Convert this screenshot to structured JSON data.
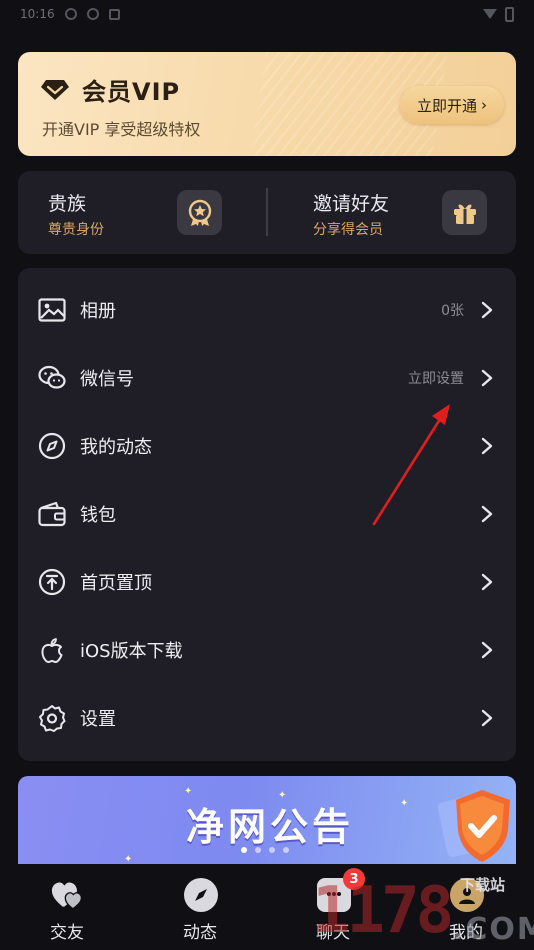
{
  "status_bar": {
    "time": "10:16"
  },
  "vip": {
    "title": "会员VIP",
    "subtitle": "开通VIP 享受超级特权",
    "button_label": "立即开通",
    "button_chevron": "›"
  },
  "noble": {
    "left": {
      "title": "贵族",
      "subtitle": "尊贵身份",
      "icon": "noble-badge-icon"
    },
    "right": {
      "title": "邀请好友",
      "subtitle": "分享得会员",
      "icon": "gift-icon"
    }
  },
  "menu": {
    "items": [
      {
        "label": "相册",
        "value": "0张",
        "icon": "image-icon"
      },
      {
        "label": "微信号",
        "value": "立即设置",
        "icon": "wechat-icon"
      },
      {
        "label": "我的动态",
        "value": "",
        "icon": "compass-icon"
      },
      {
        "label": "钱包",
        "value": "",
        "icon": "wallet-icon"
      },
      {
        "label": "首页置顶",
        "value": "",
        "icon": "pin-top-icon"
      },
      {
        "label": "iOS版本下载",
        "value": "",
        "icon": "apple-icon"
      },
      {
        "label": "设置",
        "value": "",
        "icon": "gear-icon"
      }
    ]
  },
  "banner": {
    "title": "净网公告",
    "active_dot": 0,
    "dot_count": 4
  },
  "bottom_nav": {
    "items": [
      {
        "label": "交友",
        "icon": "hearts-icon"
      },
      {
        "label": "动态",
        "icon": "compass-icon"
      },
      {
        "label": "聊天",
        "icon": "chat-icon",
        "badge": "3"
      },
      {
        "label": "我的",
        "icon": "profile-icon"
      }
    ]
  },
  "watermark": {
    "digits": "1178",
    "site": "下载站",
    "domain": ".COM"
  },
  "colors": {
    "background": "#0f0f14",
    "card": "#1f1e26",
    "vip_gold": "#f7d9a8",
    "accent_gold": "#d8a867",
    "badge_red": "#f23a3a",
    "annotation_red": "#e01e1e"
  }
}
